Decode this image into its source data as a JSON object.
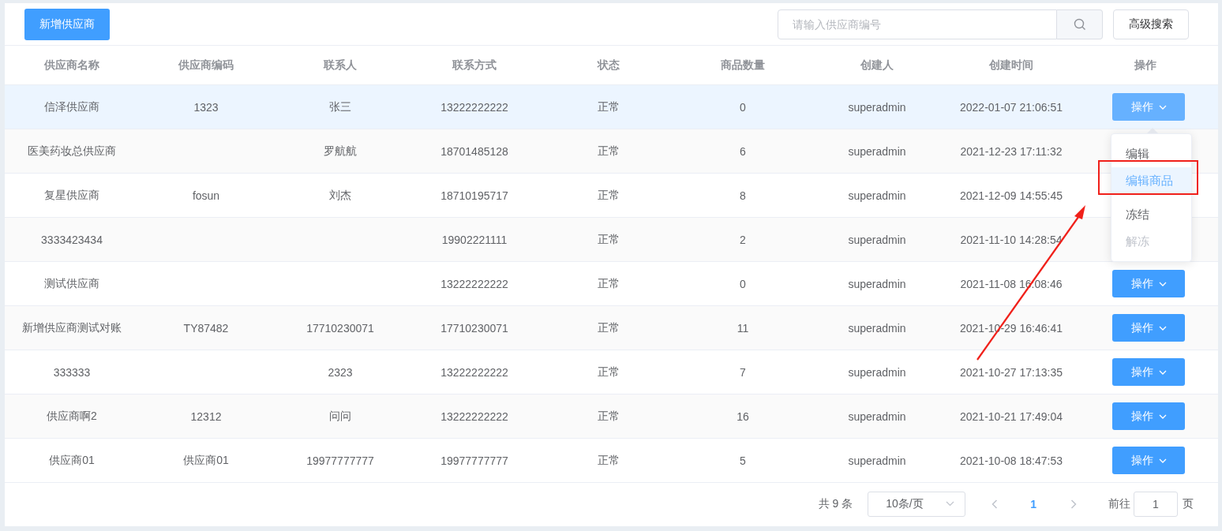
{
  "toolbar": {
    "add_button": "新增供应商",
    "search": {
      "placeholder": "请输入供应商编号"
    },
    "advanced_button": "高级搜索"
  },
  "table": {
    "columns": [
      "供应商名称",
      "供应商编码",
      "联系人",
      "联系方式",
      "状态",
      "商品数量",
      "创建人",
      "创建时间",
      "操作"
    ],
    "rows": [
      {
        "selected": true,
        "cells": [
          "信泽供应商",
          "1323",
          "张三",
          "13222222222",
          "正常",
          "0",
          "superadmin",
          "2022-01-07 21:06:51"
        ],
        "action": {
          "label": "操作",
          "active": true
        }
      },
      {
        "selected": false,
        "cells": [
          "医美药妆总供应商",
          "",
          "罗航航",
          "18701485128",
          "正常",
          "6",
          "superadmin",
          "2021-12-23 17:11:32"
        ]
      },
      {
        "selected": false,
        "cells": [
          "复星供应商",
          "fosun",
          "刘杰",
          "18710195717",
          "正常",
          "8",
          "superadmin",
          "2021-12-09 14:55:45"
        ]
      },
      {
        "selected": false,
        "cells": [
          "3333423434",
          "",
          "",
          "19902221111",
          "正常",
          "2",
          "superadmin",
          "2021-11-10 14:28:54"
        ]
      },
      {
        "selected": false,
        "cells": [
          "测试供应商",
          "",
          "",
          "13222222222",
          "正常",
          "0",
          "superadmin",
          "2021-11-08 16:08:46"
        ],
        "action": {
          "label": "操作",
          "active": false
        }
      },
      {
        "selected": false,
        "cells": [
          "新增供应商测试对账",
          "TY87482",
          "17710230071",
          "17710230071",
          "正常",
          "11",
          "superadmin",
          "2021-10-29 16:46:41"
        ],
        "action": {
          "label": "操作",
          "active": false
        }
      },
      {
        "selected": false,
        "cells": [
          "333333",
          "",
          "2323",
          "13222222222",
          "正常",
          "7",
          "superadmin",
          "2021-10-27 17:13:35"
        ],
        "action": {
          "label": "操作",
          "active": false
        }
      },
      {
        "selected": false,
        "cells": [
          "供应商啊2",
          "12312",
          "问问",
          "13222222222",
          "正常",
          "16",
          "superadmin",
          "2021-10-21 17:49:04"
        ],
        "action": {
          "label": "操作",
          "active": false
        }
      },
      {
        "selected": false,
        "cells": [
          "供应商01",
          "供应商01",
          "19977777777",
          "19977777777",
          "正常",
          "5",
          "superadmin",
          "2021-10-08 18:47:53"
        ],
        "action": {
          "label": "操作",
          "active": false
        }
      }
    ]
  },
  "dropdown_menu": {
    "items": [
      {
        "label": "编辑",
        "selected": false,
        "disabled": false
      },
      {
        "label": "编辑商品",
        "selected": true,
        "disabled": false
      },
      {
        "label": "冻结",
        "selected": false,
        "disabled": false
      },
      {
        "label": "解冻",
        "selected": false,
        "disabled": true
      }
    ]
  },
  "pagination": {
    "total": "共 9 条",
    "page_size": "10条/页",
    "pages": [
      {
        "label": "1",
        "selected": true
      }
    ],
    "goto_label": "前往",
    "goto_value": "1",
    "page_suffix": "页"
  }
}
